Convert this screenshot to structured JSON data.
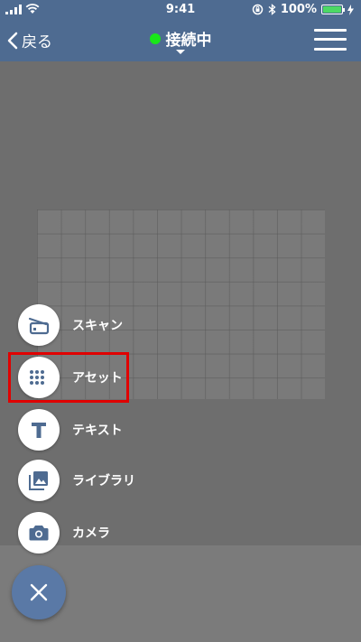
{
  "status_bar": {
    "time": "9:41",
    "battery_percent": "100%"
  },
  "nav": {
    "back_label": "戻る",
    "title": "接続中"
  },
  "colors": {
    "nav_bg": "#4e6b91",
    "connected_dot": "#19e619",
    "icon": "#4e6b91",
    "highlight": "#e00000",
    "fab": "#5a79a6"
  },
  "fab_menu": {
    "items": [
      {
        "label": "スキャン",
        "icon": "scanner-icon"
      },
      {
        "label": "アセット",
        "icon": "grid-dots-icon"
      },
      {
        "label": "テキスト",
        "icon": "text-t-icon"
      },
      {
        "label": "ライブラリ",
        "icon": "photo-library-icon"
      },
      {
        "label": "カメラ",
        "icon": "camera-icon"
      }
    ],
    "close_icon": "close-icon"
  }
}
